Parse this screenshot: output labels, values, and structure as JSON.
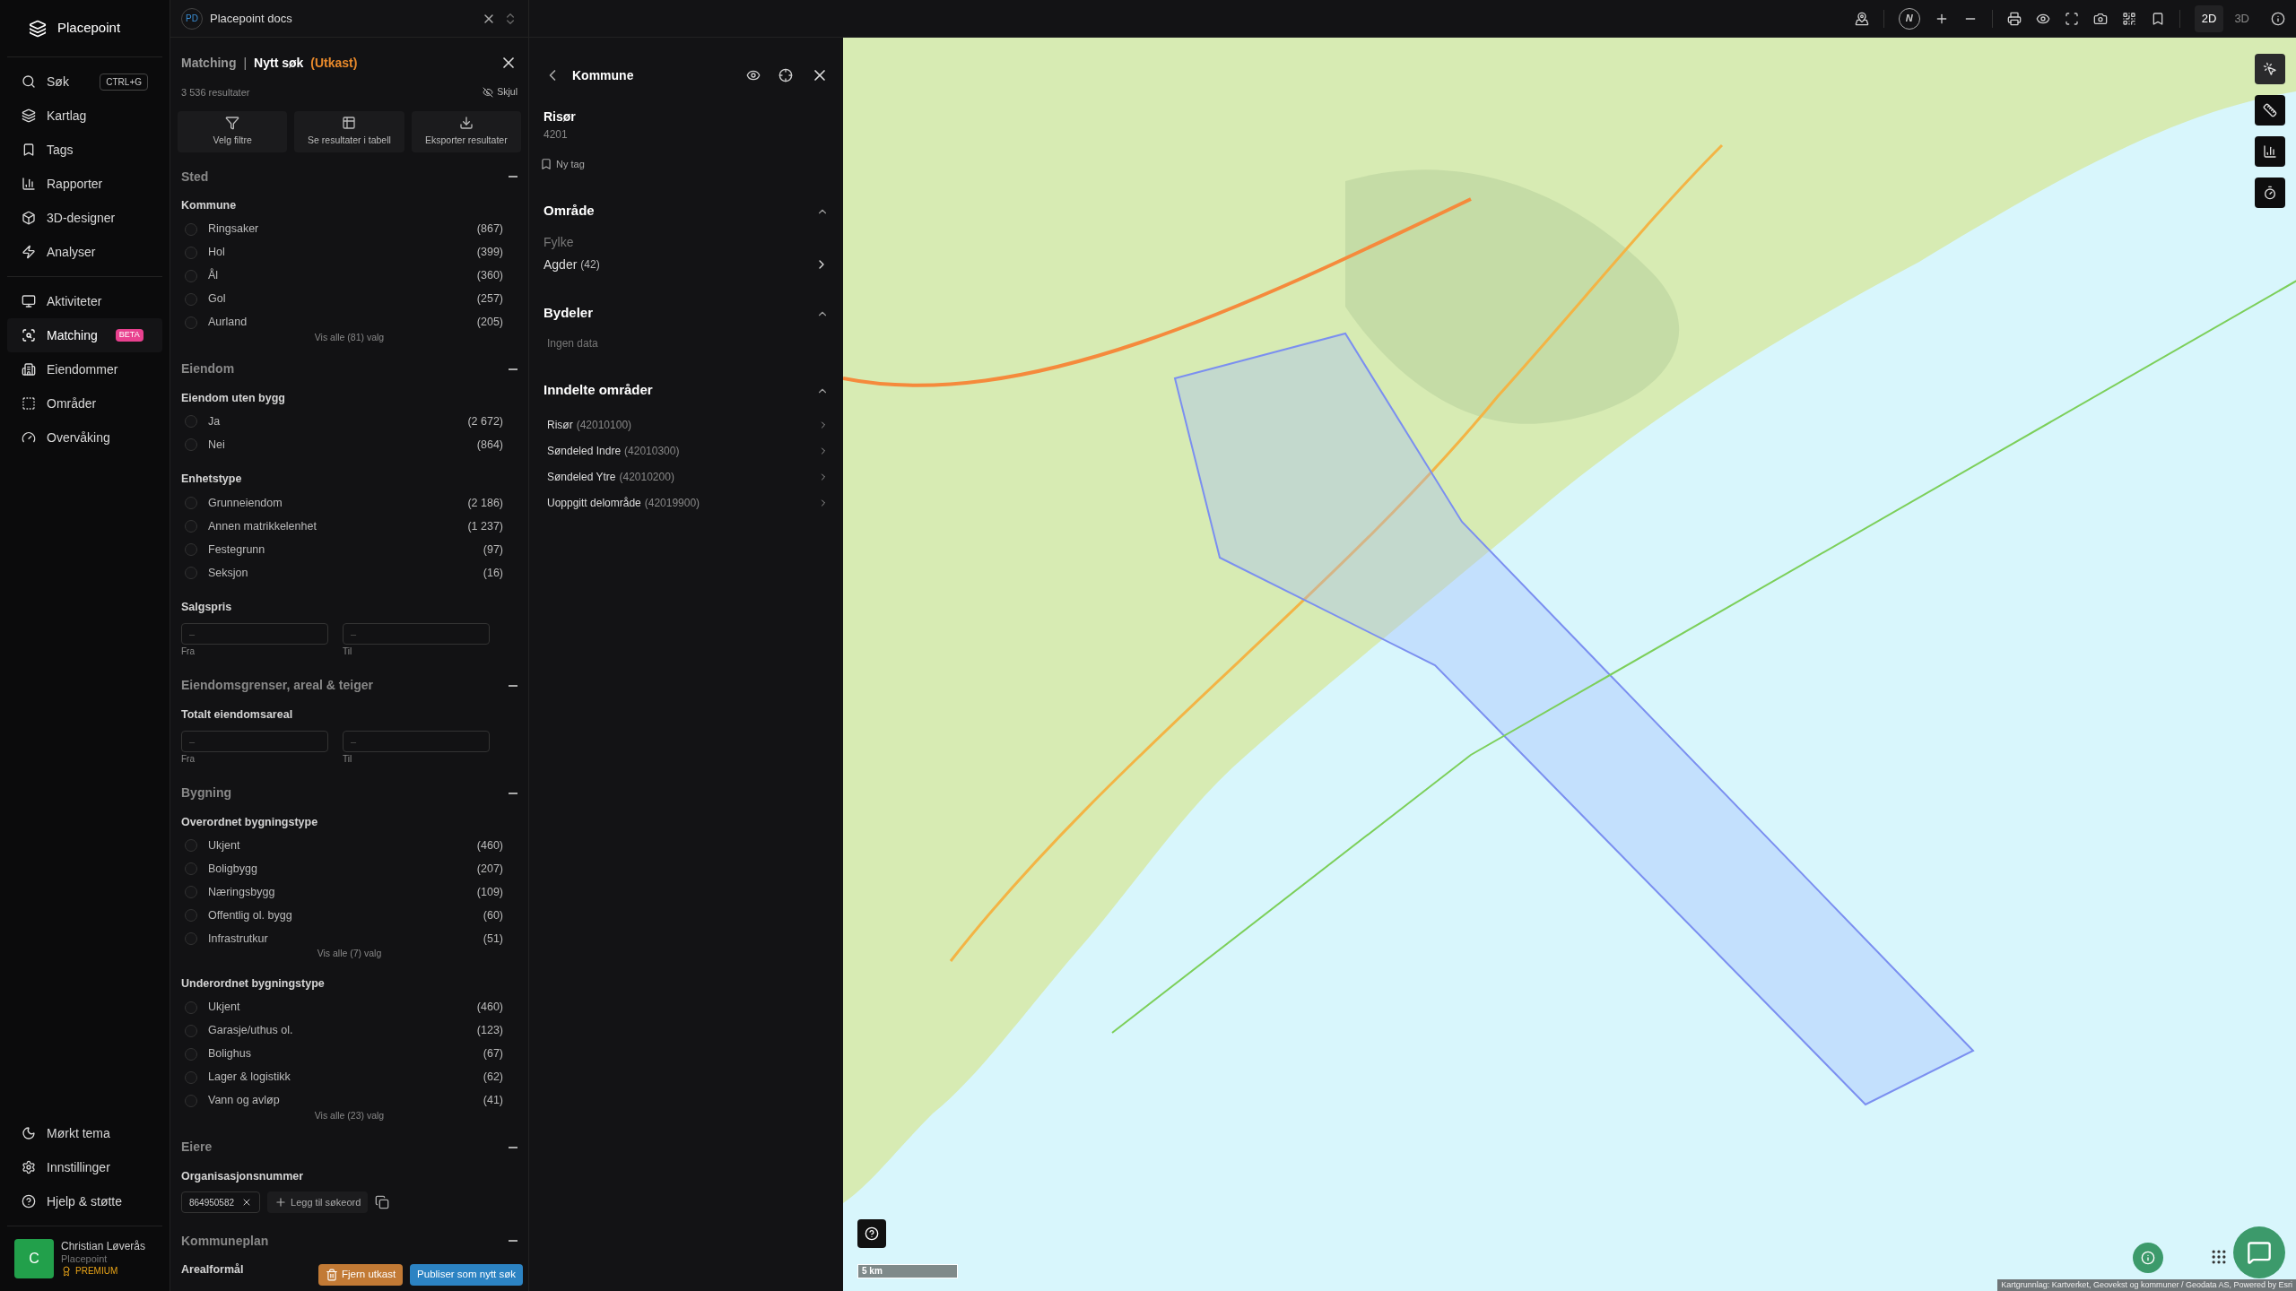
{
  "sidebar": {
    "brand": "Placepoint",
    "nav_groups": [
      [
        {
          "label": "Søk",
          "shortcut": "CTRL+G",
          "selected": false
        },
        {
          "label": "Kartlag",
          "selected": false
        },
        {
          "label": "Tags",
          "selected": false
        },
        {
          "label": "Rapporter",
          "selected": false
        },
        {
          "label": "3D-designer",
          "selected": false
        },
        {
          "label": "Analyser",
          "selected": false
        }
      ],
      [
        {
          "label": "Aktiviteter",
          "selected": false
        },
        {
          "label": "Matching",
          "badge": "BETA",
          "selected": true
        },
        {
          "label": "Eiendommer",
          "selected": false
        },
        {
          "label": "Områder",
          "selected": false
        },
        {
          "label": "Overvåking",
          "selected": false
        }
      ]
    ],
    "bottom_items": [
      {
        "label": "Mørkt tema"
      },
      {
        "label": "Innstillinger"
      },
      {
        "label": "Hjelp & støtte"
      }
    ],
    "user": {
      "initial": "C",
      "name": "Christian Løverås",
      "org": "Placepoint",
      "plan": "PREMIUM"
    }
  },
  "workspace": {
    "initials": "PD",
    "name": "Placepoint docs"
  },
  "map_toolbar": {
    "compass": "N",
    "view_modes": [
      {
        "label": "2D",
        "selected": true
      },
      {
        "label": "3D",
        "selected": false
      }
    ]
  },
  "filter_panel": {
    "breadcrumb": "Matching",
    "separator": "|",
    "title": "Nytt søk",
    "status": "(Utkast)",
    "result_count": "3 536 resultater",
    "hide_label": "Skjul",
    "actions": [
      "Velg filtre",
      "Se resultater i tabell",
      "Eksporter resultater"
    ],
    "sections": [
      {
        "title": "Sted",
        "expanded": true,
        "groups": [
          {
            "kind": "options",
            "label": "Kommune",
            "show_all": "Vis alle (81) valg",
            "options": [
              {
                "label": "Ringsaker",
                "count": "(867)",
                "checked": false
              },
              {
                "label": "Hol",
                "count": "(399)",
                "checked": false
              },
              {
                "label": "Ål",
                "count": "(360)",
                "checked": false
              },
              {
                "label": "Gol",
                "count": "(257)",
                "checked": false
              },
              {
                "label": "Aurland",
                "count": "(205)",
                "checked": false
              }
            ]
          }
        ]
      },
      {
        "title": "Eiendom",
        "expanded": true,
        "groups": [
          {
            "kind": "options",
            "label": "Eiendom uten bygg",
            "options": [
              {
                "label": "Ja",
                "count": "(2 672)",
                "checked": false
              },
              {
                "label": "Nei",
                "count": "(864)",
                "checked": false
              }
            ]
          },
          {
            "kind": "options",
            "label": "Enhetstype",
            "options": [
              {
                "label": "Grunneiendom",
                "count": "(2 186)",
                "checked": false
              },
              {
                "label": "Annen matrikkelenhet",
                "count": "(1 237)",
                "checked": false
              },
              {
                "label": "Festegrunn",
                "count": "(97)",
                "checked": false
              },
              {
                "label": "Seksjon",
                "count": "(16)",
                "checked": false
              }
            ]
          },
          {
            "kind": "range",
            "label": "Salgspris",
            "from_placeholder": "–",
            "to_placeholder": "–",
            "from_label": "Fra",
            "to_label": "Til"
          }
        ]
      },
      {
        "title": "Eiendomsgrenser, areal & teiger",
        "expanded": true,
        "groups": [
          {
            "kind": "range",
            "label": "Totalt eiendomsareal",
            "from_placeholder": "–",
            "to_placeholder": "–",
            "from_label": "Fra",
            "to_label": "Til"
          }
        ]
      },
      {
        "title": "Bygning",
        "expanded": true,
        "groups": [
          {
            "kind": "options",
            "label": "Overordnet bygningstype",
            "show_all": "Vis alle (7) valg",
            "options": [
              {
                "label": "Ukjent",
                "count": "(460)",
                "checked": false
              },
              {
                "label": "Boligbygg",
                "count": "(207)",
                "checked": false
              },
              {
                "label": "Næringsbygg",
                "count": "(109)",
                "checked": false
              },
              {
                "label": "Offentlig ol. bygg",
                "count": "(60)",
                "checked": false
              },
              {
                "label": "Infrastrutkur",
                "count": "(51)",
                "checked": false
              }
            ]
          },
          {
            "kind": "options",
            "label": "Underordnet bygningstype",
            "show_all": "Vis alle (23) valg",
            "options": [
              {
                "label": "Ukjent",
                "count": "(460)",
                "checked": false
              },
              {
                "label": "Garasje/uthus ol.",
                "count": "(123)",
                "checked": false
              },
              {
                "label": "Bolighus",
                "count": "(67)",
                "checked": false
              },
              {
                "label": "Lager & logistikk",
                "count": "(62)",
                "checked": false
              },
              {
                "label": "Vann og avløp",
                "count": "(41)",
                "checked": false
              }
            ]
          }
        ]
      },
      {
        "title": "Eiere",
        "expanded": true,
        "groups": [
          {
            "kind": "tags",
            "label": "Organisasjonsnummer",
            "tags": [
              "864950582"
            ],
            "add_label": "Legg til søkeord"
          }
        ]
      },
      {
        "title": "Kommuneplan",
        "expanded": true,
        "groups": [
          {
            "kind": "heading",
            "label": "Arealformål"
          }
        ]
      }
    ],
    "footer": {
      "discard": "Fjern utkast",
      "publish": "Publiser som nytt søk"
    }
  },
  "detail_panel": {
    "header": "Kommune",
    "name": "Risør",
    "code": "4201",
    "tag_label": "Ny tag",
    "sections": [
      {
        "kind": "field",
        "title": "Område",
        "expanded": true,
        "field_label": "Fylke",
        "field_value": "Agder",
        "field_code": "(42)"
      },
      {
        "kind": "empty",
        "title": "Bydeler",
        "expanded": true,
        "message": "Ingen data"
      },
      {
        "kind": "list",
        "title": "Inndelte områder",
        "expanded": true,
        "items": [
          {
            "name": "Risør",
            "code": "(42010100)"
          },
          {
            "name": "Søndeled Indre",
            "code": "(42010300)"
          },
          {
            "name": "Søndeled Ytre",
            "code": "(42010200)"
          },
          {
            "name": "Uoppgitt delområde",
            "code": "(42019900)"
          }
        ]
      }
    ]
  },
  "map": {
    "scale": "5 km",
    "attribution": "Kartgrunnlag: Kartverket, Geovekst og kommuner / Geodata AS, Powered by Esri"
  }
}
